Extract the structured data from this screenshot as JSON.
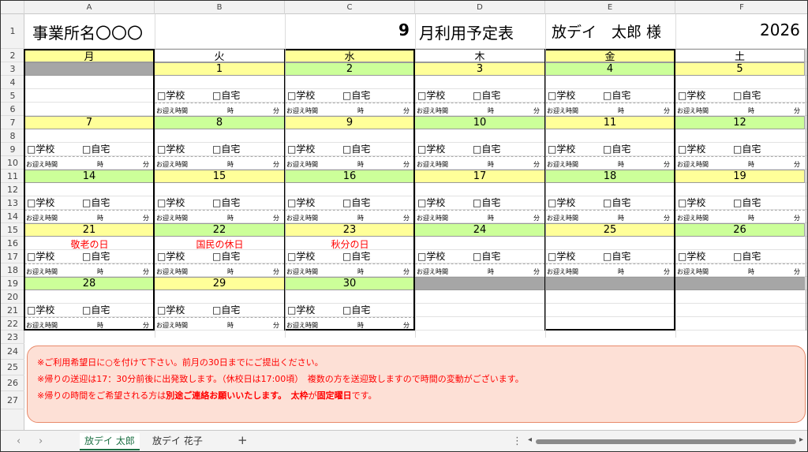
{
  "columns": [
    "A",
    "B",
    "C",
    "D",
    "E",
    "F"
  ],
  "rows": [
    "1",
    "2",
    "3",
    "4",
    "5",
    "6",
    "7",
    "8",
    "9",
    "10",
    "11",
    "12",
    "13",
    "14",
    "15",
    "16",
    "17",
    "18",
    "19",
    "20",
    "21",
    "22",
    "23",
    "24",
    "25",
    "26",
    "27"
  ],
  "header": {
    "office": "事業所名〇〇〇",
    "month_number": "9",
    "month_title": "月利用予定表",
    "recipient": "放デイ　太郎 様",
    "year": "2026"
  },
  "weekdays": [
    "月",
    "火",
    "水",
    "木",
    "金",
    "土"
  ],
  "option_school": "□学校",
  "option_home": "□自宅",
  "pickup_label": "お迎え時間",
  "hour_label": "時",
  "minute_label": "分",
  "weeks": [
    {
      "days": [
        "",
        "1",
        "2",
        "3",
        "4",
        "5"
      ]
    },
    {
      "days": [
        "7",
        "8",
        "9",
        "10",
        "11",
        "12"
      ]
    },
    {
      "days": [
        "14",
        "15",
        "16",
        "17",
        "18",
        "19"
      ]
    },
    {
      "days": [
        "21",
        "22",
        "23",
        "24",
        "25",
        "26"
      ]
    },
    {
      "days": [
        "28",
        "29",
        "30",
        "",
        "",
        ""
      ]
    }
  ],
  "holidays": {
    "mon": "敬老の日",
    "tue": "国民の休日",
    "wed": "秋分の日"
  },
  "notes": {
    "line1": "※ご利用希望日に○を付けて下さい。前月の30日までにご提出ください。",
    "line2": "※帰りの送迎は17：30分前後に出発致します。（休校日は17:00頃）　複数の方を送迎致しますので時間の変動がございます。",
    "line3_pre": "※帰りの時間をご希望される方は",
    "line3_bold1": "別途ご連絡お願いいたします。",
    "line3_mid": "　",
    "line3_bold2": "太枠",
    "line3_mid2": "が",
    "line3_bold3": "固定曜日",
    "line3_post": "です。"
  },
  "tabs": [
    "放デイ 太郎",
    "放デイ 花子"
  ],
  "add_tab": "+",
  "nav_prev": "‹",
  "nav_next": "›",
  "more": "⋮",
  "colors": {
    "yellow": "#ffff99",
    "green": "#ccff99",
    "gray": "#a6a6a6",
    "holiday_red": "#ff0000",
    "notes_bg": "#fde0d6",
    "active_tab": "#1e7145"
  }
}
